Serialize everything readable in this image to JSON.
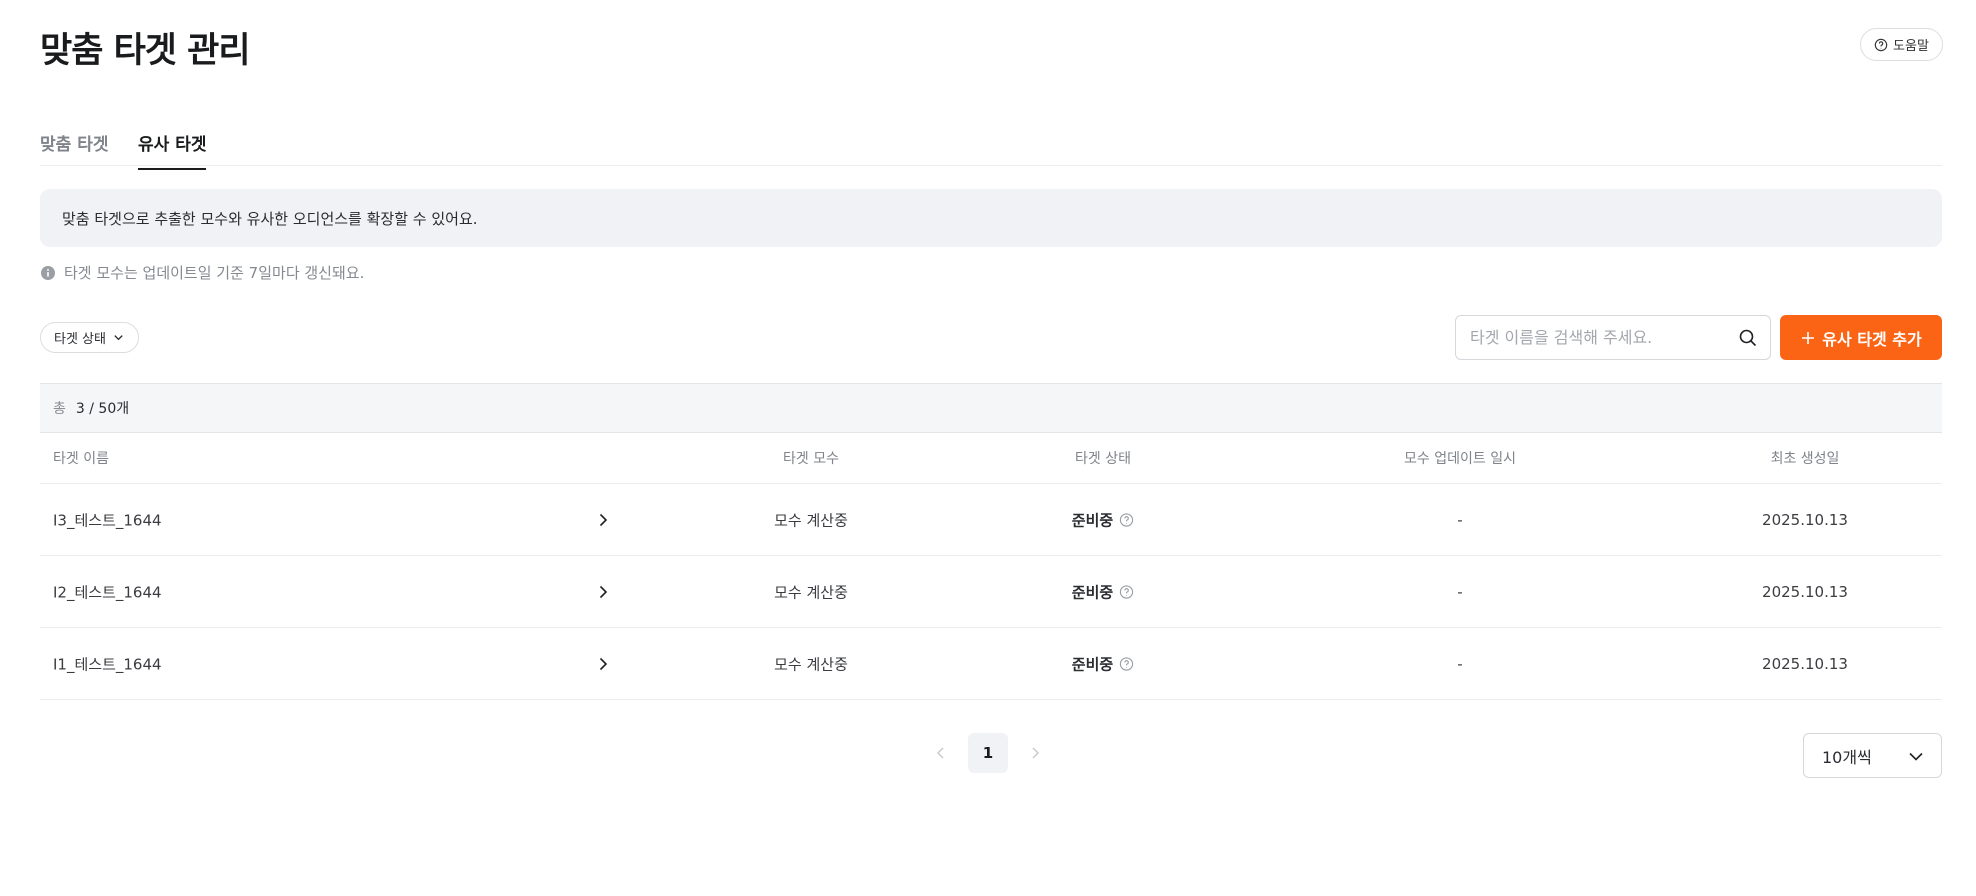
{
  "header": {
    "title": "맞춤 타겟 관리",
    "help_label": "도움말"
  },
  "tabs": [
    {
      "label": "맞춤 타겟",
      "active": false
    },
    {
      "label": "유사 타겟",
      "active": true
    }
  ],
  "notice": {
    "text": "맞춤 타겟으로 추출한 모수와 유사한 오디언스를 확장할 수 있어요.",
    "info": "타겟 모수는 업데이트일 기준 7일마다 갱신돼요."
  },
  "toolbar": {
    "filter_label": "타겟 상태",
    "search_placeholder": "타겟 이름을 검색해 주세요.",
    "add_label": "유사 타겟 추가",
    "accent_color": "#fa6414"
  },
  "table": {
    "total_label": "총",
    "total_value": "3 / 50개",
    "columns": [
      "타겟 이름",
      "타겟 모수",
      "타겟 상태",
      "모수 업데이트 일시",
      "최초 생성일"
    ],
    "rows": [
      {
        "name": "I3_테스트_1644",
        "size": "모수 계산중",
        "status": "준비중",
        "updated": "-",
        "created": "2025.10.13"
      },
      {
        "name": "I2_테스트_1644",
        "size": "모수 계산중",
        "status": "준비중",
        "updated": "-",
        "created": "2025.10.13"
      },
      {
        "name": "I1_테스트_1644",
        "size": "모수 계산중",
        "status": "준비중",
        "updated": "-",
        "created": "2025.10.13"
      }
    ]
  },
  "pagination": {
    "current_page": "1",
    "per_page_label": "10개씩"
  }
}
